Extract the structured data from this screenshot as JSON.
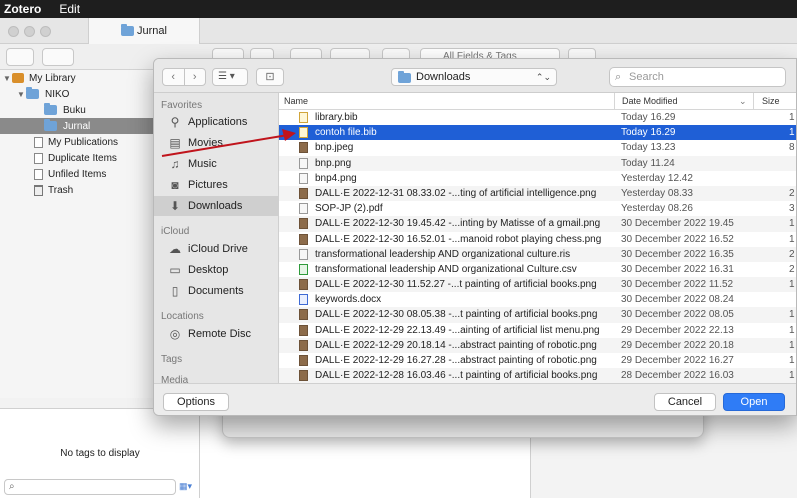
{
  "menubar": {
    "app": "Zotero",
    "edit": "Edit"
  },
  "zotero": {
    "tab_title": "Jurnal",
    "search_placeholder": "All Fields & Tags",
    "tree": [
      {
        "label": "My Library",
        "level": 0,
        "icon": "library-icon",
        "expanded": true
      },
      {
        "label": "NIKO",
        "level": 1,
        "icon": "folder-icon",
        "expanded": true
      },
      {
        "label": "Buku",
        "level": 2,
        "icon": "folder-icon"
      },
      {
        "label": "Jurnal",
        "level": 2,
        "icon": "folder-icon",
        "selected": true
      },
      {
        "label": "My Publications",
        "level": 1,
        "icon": "document-icon"
      },
      {
        "label": "Duplicate Items",
        "level": 1,
        "icon": "document-icon"
      },
      {
        "label": "Unfiled Items",
        "level": 1,
        "icon": "document-icon"
      },
      {
        "label": "Trash",
        "level": 1,
        "icon": "trash-icon"
      }
    ],
    "no_tags": "No tags to display"
  },
  "dialog": {
    "location": "Downloads",
    "search_placeholder": "Search",
    "sidebar": {
      "favorites_header": "Favorites",
      "favorites": [
        {
          "label": "Applications",
          "icon": "applications-icon"
        },
        {
          "label": "Movies",
          "icon": "movies-icon"
        },
        {
          "label": "Music",
          "icon": "music-icon"
        },
        {
          "label": "Pictures",
          "icon": "pictures-icon"
        },
        {
          "label": "Downloads",
          "icon": "downloads-icon",
          "selected": true
        }
      ],
      "icloud_header": "iCloud",
      "icloud": [
        {
          "label": "iCloud Drive",
          "icon": "icloud-icon"
        },
        {
          "label": "Desktop",
          "icon": "desktop-icon"
        },
        {
          "label": "Documents",
          "icon": "documents-icon"
        }
      ],
      "locations_header": "Locations",
      "locations": [
        {
          "label": "Remote Disc",
          "icon": "disc-icon"
        }
      ],
      "tags_header": "Tags",
      "media_header": "Media"
    },
    "columns": {
      "name": "Name",
      "date": "Date Modified",
      "size": "Size"
    },
    "files": [
      {
        "name": "library.bib",
        "date": "Today 16.29",
        "size": "1",
        "type": "bib"
      },
      {
        "name": "contoh file.bib",
        "date": "Today 16.29",
        "size": "1",
        "type": "bib",
        "selected": true
      },
      {
        "name": "bnp.jpeg",
        "date": "Today 13.23",
        "size": "8",
        "type": "img"
      },
      {
        "name": "bnp.png",
        "date": "Today 11.24",
        "size": "",
        "type": "pdf"
      },
      {
        "name": "bnp4.png",
        "date": "Yesterday 12.42",
        "size": "",
        "type": "pdf"
      },
      {
        "name": "DALL·E 2022-12-31 08.33.02 -...ting of artificial intelligence.png",
        "date": "Yesterday 08.33",
        "size": "2",
        "type": "img"
      },
      {
        "name": "SOP-JP (2).pdf",
        "date": "Yesterday 08.26",
        "size": "3",
        "type": "pdf"
      },
      {
        "name": "DALL·E 2022-12-30 19.45.42 -...inting by Matisse of a gmail.png",
        "date": "30 December 2022 19.45",
        "size": "1",
        "type": "img"
      },
      {
        "name": "DALL·E 2022-12-30 16.52.01 -...manoid robot playing chess.png",
        "date": "30 December 2022 16.52",
        "size": "1",
        "type": "img"
      },
      {
        "name": "transformational leadership AND organizational culture.ris",
        "date": "30 December 2022 16.35",
        "size": "2",
        "type": "pdf"
      },
      {
        "name": "transformational leadership AND organizational Culture.csv",
        "date": "30 December 2022 16.31",
        "size": "2",
        "type": "csv"
      },
      {
        "name": "DALL·E 2022-12-30 11.52.27 -...t painting of artificial books.png",
        "date": "30 December 2022 11.52",
        "size": "1",
        "type": "img"
      },
      {
        "name": "keywords.docx",
        "date": "30 December 2022 08.24",
        "size": "",
        "type": "doc"
      },
      {
        "name": "DALL·E 2022-12-30 08.05.38 -...t painting of artificial books.png",
        "date": "30 December 2022 08.05",
        "size": "1",
        "type": "img"
      },
      {
        "name": "DALL·E 2022-12-29 22.13.49 -...ainting of artificial list menu.png",
        "date": "29 December 2022 22.13",
        "size": "1",
        "type": "img"
      },
      {
        "name": "DALL·E 2022-12-29 20.18.14 -...abstract painting of robotic.png",
        "date": "29 December 2022 20.18",
        "size": "1",
        "type": "img"
      },
      {
        "name": "DALL·E 2022-12-29 16.27.28 -...abstract painting of robotic.png",
        "date": "29 December 2022 16.27",
        "size": "1",
        "type": "img"
      },
      {
        "name": "DALL·E 2022-12-28 16.03.46 -...t painting of artificial books.png",
        "date": "28 December 2022 16.03",
        "size": "1",
        "type": "img"
      }
    ],
    "buttons": {
      "options": "Options",
      "cancel": "Cancel",
      "open": "Open"
    }
  },
  "colors": {
    "selection": "#1f5fd6",
    "primary_button": "#2f7cf6",
    "arrow": "#c0141c"
  }
}
